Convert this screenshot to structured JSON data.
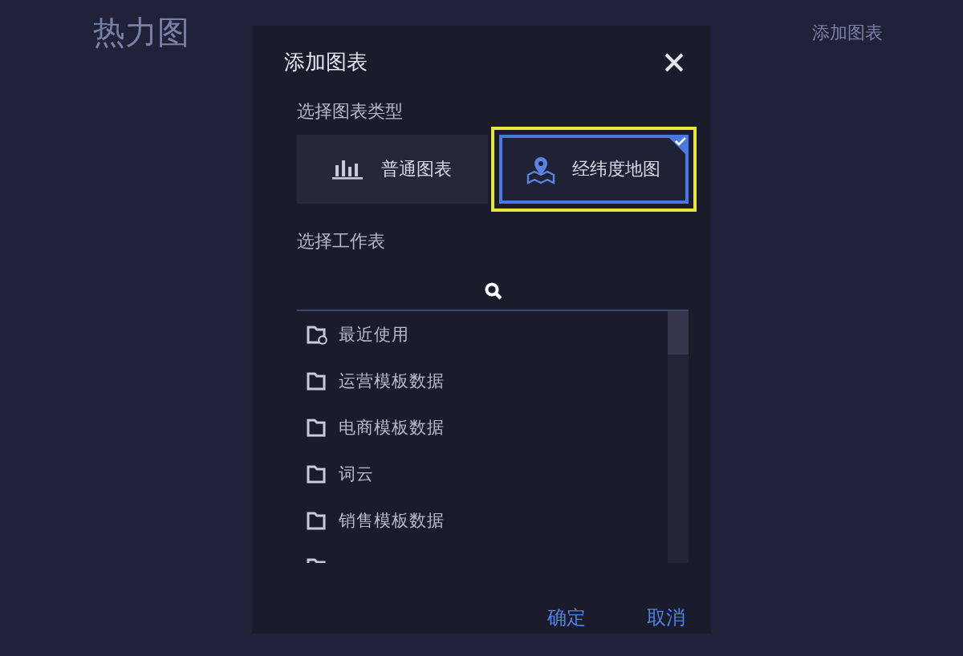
{
  "background": {
    "title": "热力图",
    "toolbar_button": "添加图表"
  },
  "dialog": {
    "title": "添加图表",
    "type_label": "选择图表类型",
    "chart_types": [
      {
        "kind": "bar",
        "label": "普通图表",
        "selected": false
      },
      {
        "kind": "map",
        "label": "经纬度地图",
        "selected": true
      }
    ],
    "sheet_label": "选择工作表",
    "worksheets": [
      {
        "kind": "recent",
        "label": "最近使用"
      },
      {
        "kind": "folder",
        "label": "运营模板数据"
      },
      {
        "kind": "folder",
        "label": "电商模板数据"
      },
      {
        "kind": "folder",
        "label": "词云"
      },
      {
        "kind": "folder",
        "label": "销售模板数据"
      }
    ],
    "buttons": [
      "确定",
      "取消"
    ]
  }
}
